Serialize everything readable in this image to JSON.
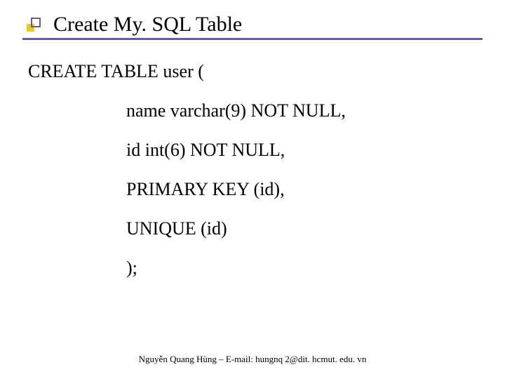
{
  "slide": {
    "title": "Create My. SQL Table",
    "lines": [
      "CREATE TABLE user (",
      "name varchar(9) NOT NULL,",
      "id int(6) NOT NULL,",
      "PRIMARY KEY (id),",
      "UNIQUE (id)",
      ");"
    ],
    "footer": "Nguyễn Quang Hùng – E-mail: hungnq 2@dit. hcmut. edu. vn"
  }
}
